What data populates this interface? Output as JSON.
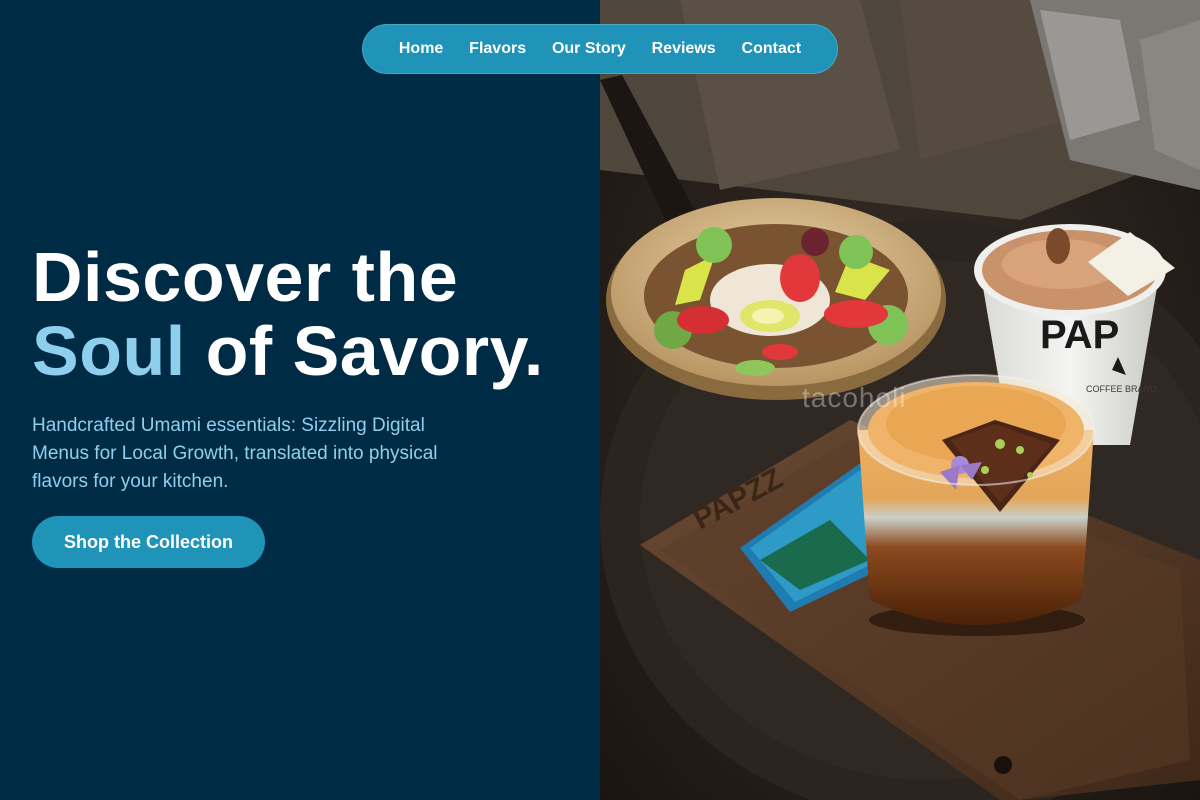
{
  "nav": {
    "items": [
      {
        "label": "Home"
      },
      {
        "label": "Flavors"
      },
      {
        "label": "Our Story"
      },
      {
        "label": "Reviews"
      },
      {
        "label": "Contact"
      }
    ]
  },
  "hero": {
    "title_line1": "Discover the",
    "title_accent": "Soul",
    "title_line2_rest": " of Savory.",
    "subtitle": "Handcrafted Umami essentials: Sizzling Digital Menus for Local Growth, translated into physical flavors for your kitchen.",
    "cta_label": "Shop the Collection"
  },
  "photo": {
    "watermark": "tacoholi",
    "cup_brand": "PAP",
    "cup_caption": "COFFEE BRAND",
    "tray_brand": "PAPZZ"
  },
  "colors": {
    "background": "#002b45",
    "accent": "#1f93b8",
    "accent_light": "#8fcfee",
    "text": "#ffffff"
  }
}
